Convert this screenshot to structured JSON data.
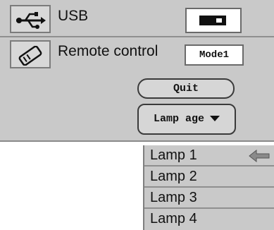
{
  "rows": [
    {
      "label": "USB",
      "icon": "usb-icon",
      "value_icon": "battery-plug-icon"
    },
    {
      "label": "Remote control",
      "icon": "remote-icon",
      "value": "Mode1"
    }
  ],
  "buttons": {
    "quit_label": "Quit",
    "lamp_age_label": "Lamp age"
  },
  "lamp_menu": {
    "items": [
      "Lamp 1",
      "Lamp 2",
      "Lamp 3",
      "Lamp 4"
    ],
    "selected_index": 0
  },
  "colors": {
    "panel_bg": "#c9c9c9",
    "box_bg": "#ffffff",
    "text": "#111111"
  }
}
